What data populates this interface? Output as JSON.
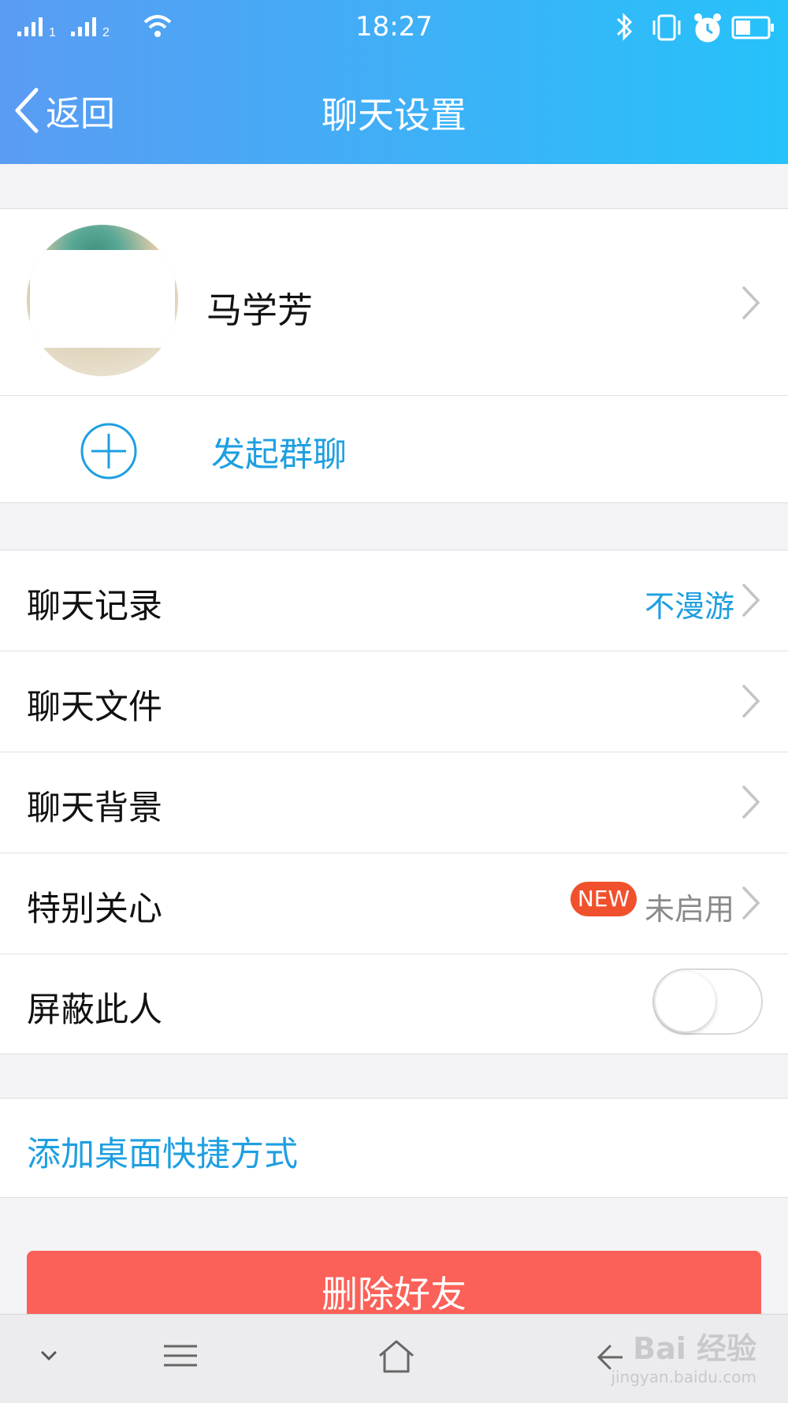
{
  "status_bar": {
    "time": "18:27",
    "sim1": "1",
    "sim2": "2"
  },
  "nav": {
    "back_label": "返回",
    "title": "聊天设置"
  },
  "contact": {
    "name": "马学芳"
  },
  "group_chat": {
    "label": "发起群聊"
  },
  "settings": [
    {
      "label": "聊天记录",
      "value": "不漫游"
    },
    {
      "label": "聊天文件"
    },
    {
      "label": "聊天背景"
    },
    {
      "label": "特别关心",
      "badge": "NEW",
      "value": "未启用"
    },
    {
      "label": "屏蔽此人",
      "toggle_on": false
    }
  ],
  "shortcut": {
    "label": "添加桌面快捷方式"
  },
  "delete": {
    "label": "删除好友"
  },
  "watermark": {
    "main": "Bai 经验",
    "sub": "jingyan.baidu.com"
  },
  "colors": {
    "header_start": "#5a9cf3",
    "header_end": "#26c2fa",
    "accent_blue": "#1e9fe0",
    "danger": "#fb6158",
    "badge": "#f0512c"
  },
  "icons": [
    "signal-icon",
    "wifi-icon",
    "bluetooth-icon",
    "vibrate-icon",
    "alarm-icon",
    "battery-icon",
    "back-chevron-icon",
    "chevron-right-icon",
    "add-circle-icon",
    "collapse-icon",
    "menu-icon",
    "home-icon",
    "back-icon"
  ]
}
